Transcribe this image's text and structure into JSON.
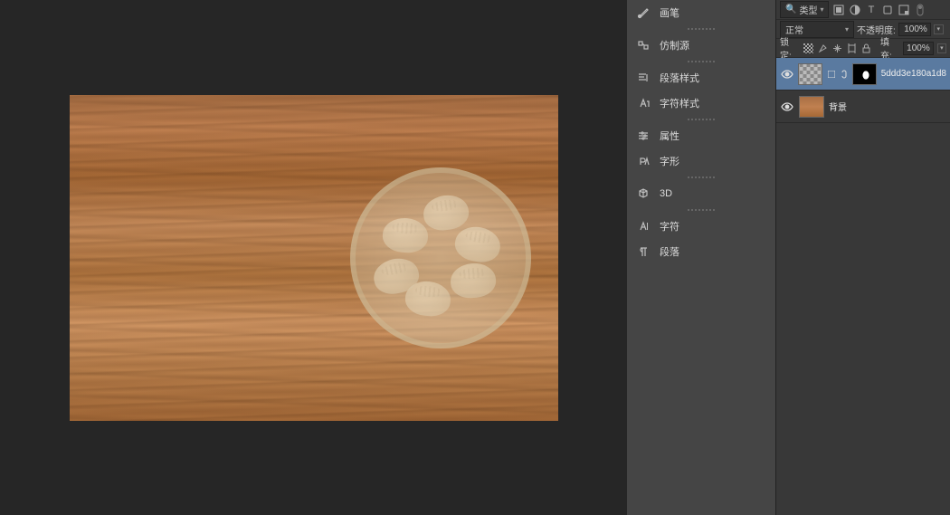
{
  "mid_panel": {
    "items": [
      {
        "icon": "brush",
        "label": "画笔"
      },
      {
        "icon": "clone",
        "label": "仿制源"
      },
      {
        "icon": "para_style",
        "label": "段落样式"
      },
      {
        "icon": "char_style",
        "label": "字符样式"
      },
      {
        "icon": "properties",
        "label": "属性"
      },
      {
        "icon": "glyphs",
        "label": "字形"
      },
      {
        "icon": "3d",
        "label": "3D"
      },
      {
        "icon": "character",
        "label": "字符"
      },
      {
        "icon": "paragraph",
        "label": "段落"
      }
    ]
  },
  "layers_panel": {
    "header": {
      "search_kind_label": "类型",
      "filter_icons": [
        "image",
        "adjust",
        "text",
        "shape",
        "smart"
      ]
    },
    "blend": {
      "mode": "正常",
      "opacity_label": "不透明度:",
      "opacity_value": "100%"
    },
    "lock": {
      "label": "锁定:",
      "fill_label": "填充:",
      "fill_value": "100%"
    },
    "layers": [
      {
        "name": "5ddd3e180a1d8",
        "selected": true,
        "has_mask": true
      },
      {
        "name": "背景",
        "selected": false,
        "has_mask": false
      }
    ]
  }
}
